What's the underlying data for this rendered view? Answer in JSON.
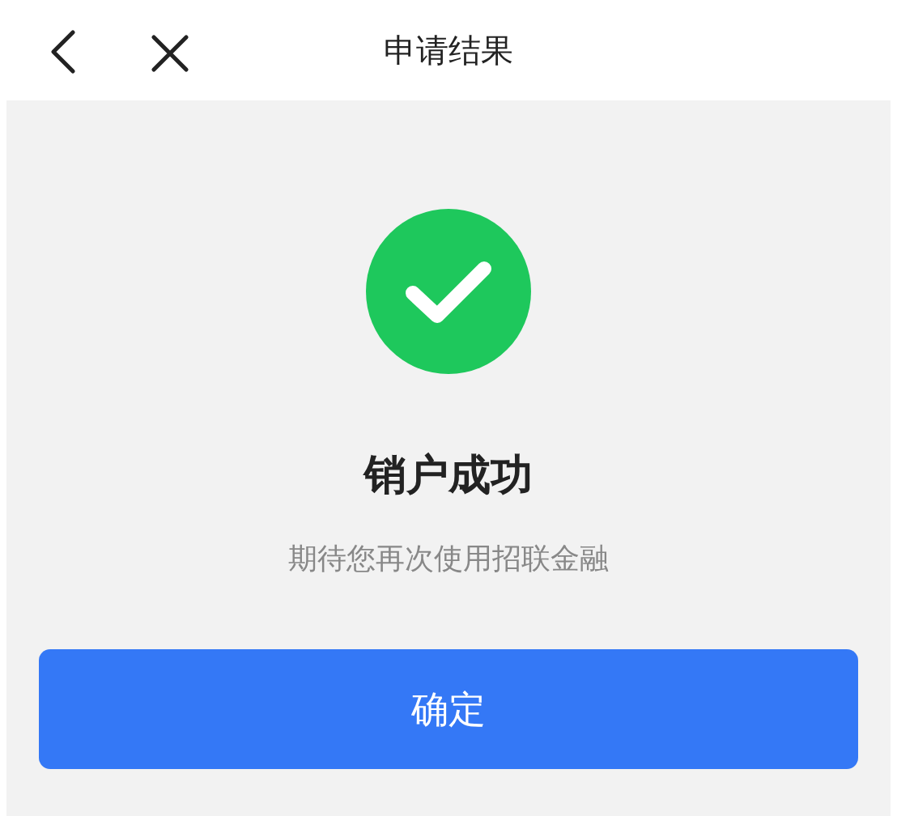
{
  "nav_bar": {
    "title": "申请结果"
  },
  "result": {
    "succeeded": true,
    "title": "销户成功",
    "message": "期待您再次使用招联金融"
  },
  "buttons": [
    {
      "label": "确定"
    }
  ]
}
